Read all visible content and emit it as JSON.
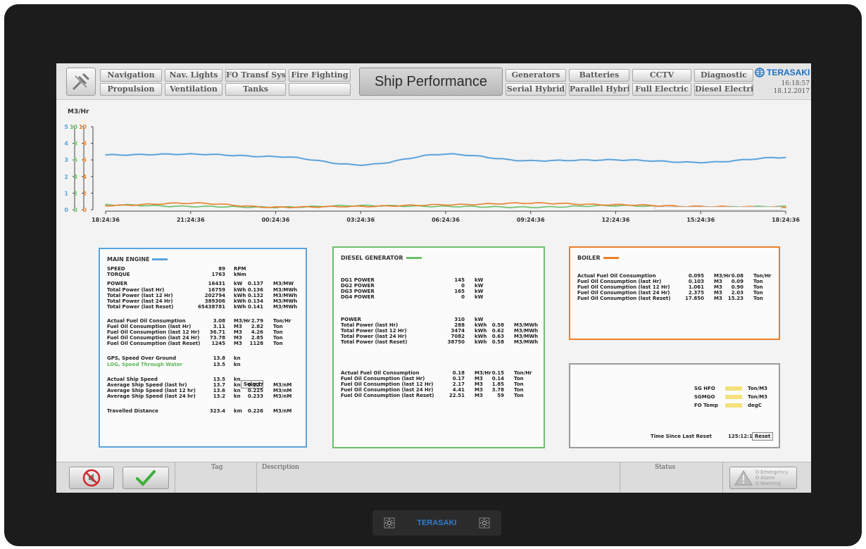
{
  "header": {
    "title": "Ship Performance",
    "brand": "TERASAKI",
    "time": "16:18:57",
    "date": "18.12.2017",
    "nav_left": [
      [
        "Navigation",
        "Nav. Lights",
        "FO Transf Syst",
        "Fire Fighting"
      ],
      [
        "Propulsion",
        "Ventilation",
        "Tanks",
        ""
      ]
    ],
    "nav_right": [
      [
        "Generators",
        "Batteries",
        "CCTV",
        "Diagnostic"
      ],
      [
        "Serial Hybrid",
        "Parallel Hybrid",
        "Full Electric",
        "Diesel Electric"
      ]
    ]
  },
  "chart": {
    "unit": "M3/Hr",
    "axis_blue": [
      "5",
      "4",
      "3",
      "2",
      "1",
      "0"
    ],
    "axis_green": [
      "10",
      "8",
      "6",
      "4",
      "2",
      "0"
    ],
    "axis_orange": [
      "10",
      "8",
      "6",
      "4",
      "2",
      "0"
    ],
    "time_labels": [
      "18:24:36",
      "21:24:36",
      "00:24:36",
      "03:24:36",
      "06:24:36",
      "09:24:36",
      "12:24:36",
      "15:24:36",
      "18:24:36"
    ],
    "colors": {
      "blue": "#5ba3dc",
      "green": "#6cbf6a",
      "orange": "#e97f2a"
    }
  },
  "chart_data": {
    "type": "line",
    "x": [
      "18:24:36",
      "21:24:36",
      "00:24:36",
      "03:24:36",
      "06:24:36",
      "09:24:36",
      "12:24:36",
      "15:24:36",
      "18:24:36"
    ],
    "series": [
      {
        "values": [
          3.3,
          3.35,
          3.2,
          2.7,
          3.35,
          2.95,
          3.0,
          2.85,
          3.15
        ]
      },
      {
        "values": [
          0.6,
          0.4,
          0.3,
          0.5,
          0.4,
          0.3,
          0.5,
          0.3,
          0.4
        ]
      },
      {
        "values": [
          0.5,
          0.8,
          0.3,
          0.4,
          0.6,
          0.8,
          0.6,
          0.4,
          0.3
        ]
      }
    ]
  },
  "main_engine": {
    "title": "MAIN ENGINE",
    "rows": [
      [
        "SPEED",
        "89",
        "RPM",
        "",
        ""
      ],
      [
        "TORQUE",
        "1763",
        "kNm",
        "",
        ""
      ],
      [
        "POWER",
        "16431",
        "kW",
        "0.137",
        "M3/MW"
      ],
      [
        "Total Power (last Hr)",
        "16759",
        "kWh",
        "0.136",
        "M3/MWh"
      ],
      [
        "Total Power (last 12 Hr)",
        "202794",
        "kWh",
        "0.132",
        "M3/MWh"
      ],
      [
        "Total Power (last 24 Hr)",
        "389306",
        "kWh",
        "0.134",
        "M3/MWh"
      ],
      [
        "Total Power (last Reset)",
        "65438781",
        "kWh",
        "0.141",
        "M3/MWh"
      ],
      [
        "Actual Fuel Oil Consumption",
        "3.08",
        "M3/Hr",
        "2.79",
        "Ton/Hr"
      ],
      [
        "Fuel Oil Consumption (last Hr)",
        "3.11",
        "M3",
        "2.82",
        "Ton"
      ],
      [
        "Fuel Oil Consumption (last 12 Hr)",
        "36.71",
        "M3",
        "4.26",
        "Ton"
      ],
      [
        "Fuel Oil Consumption (last 24 Hr)",
        "73.78",
        "M3",
        "2.85",
        "Ton"
      ],
      [
        "Fuel Oil Consumption (last Reset)",
        "1245",
        "M3",
        "1128",
        "Ton"
      ],
      [
        "GPS, Speed Over Ground",
        "13.8",
        "kn",
        "",
        ""
      ],
      [
        "LOG, Speed Through Water",
        "13.5",
        "kn",
        "",
        ""
      ],
      [
        "Actual Ship Speed",
        "13.5",
        "kn",
        "",
        ""
      ],
      [
        "Average Ship Speed (last hr)",
        "13.7",
        "kn",
        "0.227",
        "M3/nM"
      ],
      [
        "Average Ship Speed (last 12 hr)",
        "13.6",
        "kn",
        "0.225",
        "M3/nM"
      ],
      [
        "Average Ship Speed (last 24 hr)",
        "13.2",
        "kn",
        "0.233",
        "M3/nM"
      ],
      [
        "Travelled Distance",
        "323.4",
        "km",
        "0.226",
        "M3/nM"
      ]
    ],
    "select_label": "Select"
  },
  "diesel_generator": {
    "title": "DIESEL GENERATOR",
    "rows": [
      [
        "DG1 POWER",
        "145",
        "kW",
        "",
        ""
      ],
      [
        "DG2 POWER",
        "0",
        "kW",
        "",
        ""
      ],
      [
        "DG3 POWER",
        "165",
        "kW",
        "",
        ""
      ],
      [
        "DG4 POWER",
        "0",
        "kW",
        "",
        ""
      ],
      [
        "POWER",
        "310",
        "kW",
        "",
        ""
      ],
      [
        "Total Power (last Hr)",
        "288",
        "kWh",
        "0.58",
        "M3/MWh"
      ],
      [
        "Total Power (last 12 Hr)",
        "3474",
        "kWh",
        "0.62",
        "M3/MWh"
      ],
      [
        "Total Power (last 24 Hr)",
        "7082",
        "kWh",
        "0.63",
        "M3/MWh"
      ],
      [
        "Total Power (last Reset)",
        "38750",
        "kWh",
        "0.58",
        "M3/MWh"
      ],
      [
        "Actual Fuel Oil Consumption",
        "0.18",
        "M3/Hr",
        "0.15",
        "Ton/Hr"
      ],
      [
        "Fuel Oil Consumption (last Hr)",
        "0.17",
        "M3",
        "0.14",
        "Ton"
      ],
      [
        "Fuel Oil Consumption (last 12 Hr)",
        "2.17",
        "M3",
        "1.85",
        "Ton"
      ],
      [
        "Fuel Oil Consumption (last 24 Hr)",
        "4.41",
        "M3",
        "3.78",
        "Ton"
      ],
      [
        "Fuel Oil Consumption (last Reset)",
        "22.51",
        "M3",
        "59",
        "Ton"
      ]
    ]
  },
  "boiler": {
    "title": "BOILER",
    "rows": [
      [
        "Actual Fuel Oil Consumption",
        "0.095",
        "M3/Hr",
        "0.08",
        "Ton/Hr"
      ],
      [
        "Fuel Oil Consumption (last Hr)",
        "0.103",
        "M3",
        "0.09",
        "Ton"
      ],
      [
        "Fuel Oil Consumption (last 12 Hr)",
        "1.061",
        "M3",
        "0.90",
        "Ton"
      ],
      [
        "Fuel Oil Consumption (last 24 Hr)",
        "2.375",
        "M3",
        "2.03",
        "Ton"
      ],
      [
        "Fuel Oil Consumption (last Reset)",
        "17.850",
        "M3",
        "15.23",
        "Ton"
      ]
    ]
  },
  "settings": {
    "rows": [
      [
        "SG HFO",
        "Ton/M3"
      ],
      [
        "SGMGO",
        "Ton/M3"
      ],
      [
        "FO Temp",
        "degC"
      ]
    ],
    "time_label": "Time Since Last Reset",
    "time_value": "125:12:11",
    "reset_label": "Reset"
  },
  "status_bar": {
    "tag_header": "Tag",
    "description_header": "Description",
    "status_header": "Status",
    "alarm_levels": [
      "Emergency",
      "Alarm",
      "Warning"
    ]
  },
  "bezel": {
    "brand": "TERASAKI"
  }
}
